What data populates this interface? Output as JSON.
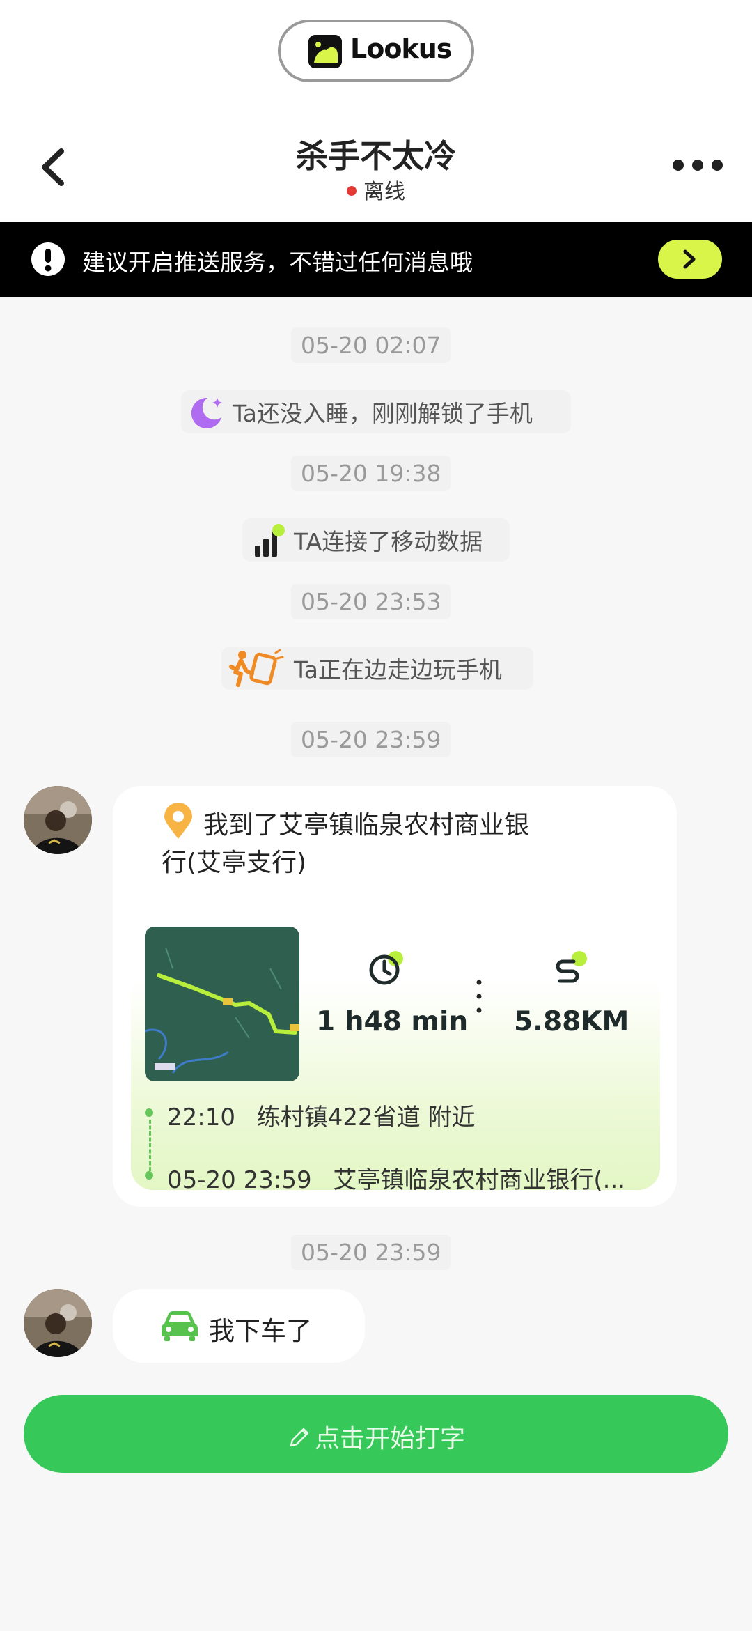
{
  "app": {
    "logo_text": "Lookus"
  },
  "header": {
    "title": "杀手不太冷",
    "status": "离线",
    "status_color": "#e53935"
  },
  "banner": {
    "text": "建议开启推送服务，不错过任何消息哦",
    "button_color": "#d9f54a"
  },
  "messages": [
    {
      "time": "05-20 02:07",
      "text": "Ta还没入睡，刚刚解锁了手机",
      "icon": "moon-icon"
    },
    {
      "time": "05-20 19:38",
      "text": "TA连接了移动数据",
      "icon": "signal-icon"
    },
    {
      "time": "05-20 23:53",
      "text": "Ta正在边走边玩手机",
      "icon": "walking-phone-icon"
    }
  ],
  "location_card": {
    "time": "05-20 23:59",
    "title": "我到了艾亭镇临泉农村商业银行(艾亭支行)",
    "duration": "1 h48 min",
    "distance": "5.88KM",
    "route": [
      {
        "time": "22:10",
        "place": "练村镇422省道 附近"
      },
      {
        "time": "05-20 23:59",
        "place": "艾亭镇临泉农村商业银行(..."
      }
    ]
  },
  "car_message": {
    "time": "05-20 23:59",
    "text": "我下车了"
  },
  "compose": {
    "placeholder": "点击开始打字",
    "color": "#36c95a"
  }
}
